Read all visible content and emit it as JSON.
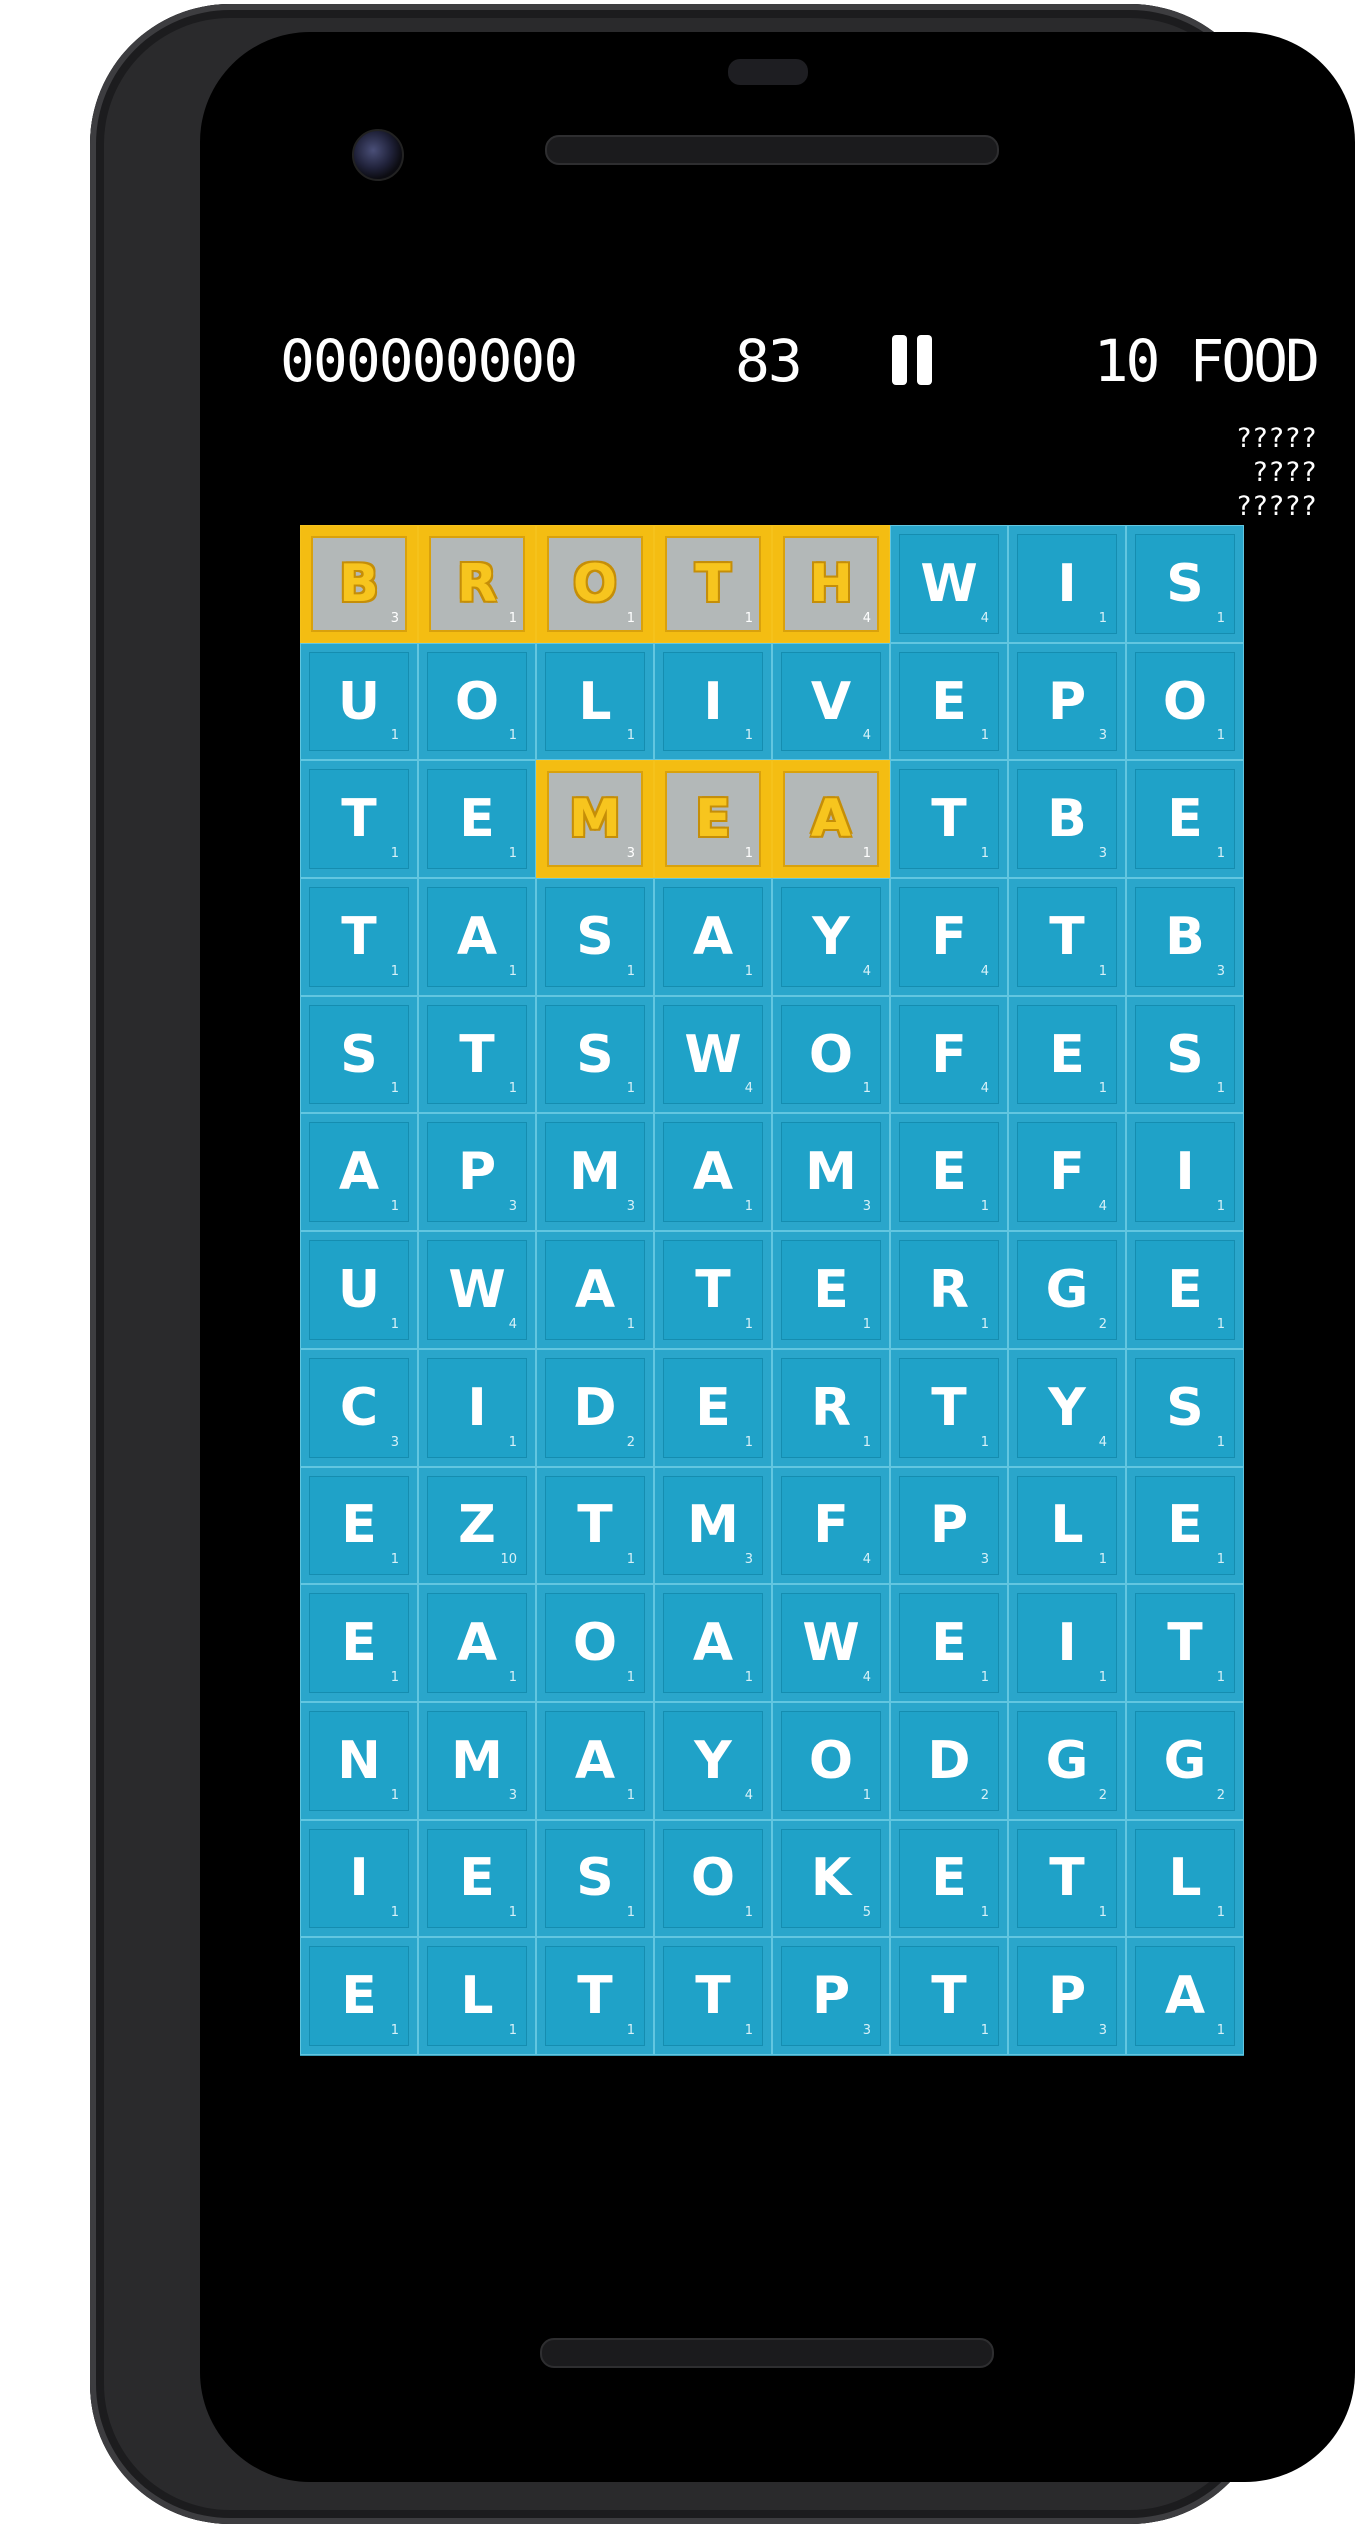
{
  "hud": {
    "score": "000000000",
    "timer": "83",
    "target": "10 FOOD"
  },
  "hints": [
    "?????",
    "????",
    "?????"
  ],
  "colors": {
    "tile": "#1fa2c8",
    "selected_tile": "#b3b8b8",
    "selected_border": "#f4bd12",
    "letter": "#ffffff",
    "selected_letter": "#f7c51e"
  },
  "board": {
    "rows": [
      [
        {
          "l": "B",
          "p": "3",
          "s": true
        },
        {
          "l": "R",
          "p": "1",
          "s": true
        },
        {
          "l": "O",
          "p": "1",
          "s": true
        },
        {
          "l": "T",
          "p": "1",
          "s": true
        },
        {
          "l": "H",
          "p": "4",
          "s": true
        },
        {
          "l": "W",
          "p": "4"
        },
        {
          "l": "I",
          "p": "1"
        },
        {
          "l": "S",
          "p": "1"
        }
      ],
      [
        {
          "l": "U",
          "p": "1"
        },
        {
          "l": "O",
          "p": "1"
        },
        {
          "l": "L",
          "p": "1"
        },
        {
          "l": "I",
          "p": "1"
        },
        {
          "l": "V",
          "p": "4"
        },
        {
          "l": "E",
          "p": "1"
        },
        {
          "l": "P",
          "p": "3"
        },
        {
          "l": "O",
          "p": "1"
        }
      ],
      [
        {
          "l": "T",
          "p": "1"
        },
        {
          "l": "E",
          "p": "1"
        },
        {
          "l": "M",
          "p": "3",
          "s": true
        },
        {
          "l": "E",
          "p": "1",
          "s": true
        },
        {
          "l": "A",
          "p": "1",
          "s": true
        },
        {
          "l": "T",
          "p": "1"
        },
        {
          "l": "B",
          "p": "3"
        },
        {
          "l": "E",
          "p": "1"
        }
      ],
      [
        {
          "l": "T",
          "p": "1"
        },
        {
          "l": "A",
          "p": "1"
        },
        {
          "l": "S",
          "p": "1"
        },
        {
          "l": "A",
          "p": "1"
        },
        {
          "l": "Y",
          "p": "4"
        },
        {
          "l": "F",
          "p": "4"
        },
        {
          "l": "T",
          "p": "1"
        },
        {
          "l": "B",
          "p": "3"
        }
      ],
      [
        {
          "l": "S",
          "p": "1"
        },
        {
          "l": "T",
          "p": "1"
        },
        {
          "l": "S",
          "p": "1"
        },
        {
          "l": "W",
          "p": "4"
        },
        {
          "l": "O",
          "p": "1"
        },
        {
          "l": "F",
          "p": "4"
        },
        {
          "l": "E",
          "p": "1"
        },
        {
          "l": "S",
          "p": "1"
        }
      ],
      [
        {
          "l": "A",
          "p": "1"
        },
        {
          "l": "P",
          "p": "3"
        },
        {
          "l": "M",
          "p": "3"
        },
        {
          "l": "A",
          "p": "1"
        },
        {
          "l": "M",
          "p": "3"
        },
        {
          "l": "E",
          "p": "1"
        },
        {
          "l": "F",
          "p": "4"
        },
        {
          "l": "I",
          "p": "1"
        }
      ],
      [
        {
          "l": "U",
          "p": "1"
        },
        {
          "l": "W",
          "p": "4"
        },
        {
          "l": "A",
          "p": "1"
        },
        {
          "l": "T",
          "p": "1"
        },
        {
          "l": "E",
          "p": "1"
        },
        {
          "l": "R",
          "p": "1"
        },
        {
          "l": "G",
          "p": "2"
        },
        {
          "l": "E",
          "p": "1"
        }
      ],
      [
        {
          "l": "C",
          "p": "3"
        },
        {
          "l": "I",
          "p": "1"
        },
        {
          "l": "D",
          "p": "2"
        },
        {
          "l": "E",
          "p": "1"
        },
        {
          "l": "R",
          "p": "1"
        },
        {
          "l": "T",
          "p": "1"
        },
        {
          "l": "Y",
          "p": "4"
        },
        {
          "l": "S",
          "p": "1"
        }
      ],
      [
        {
          "l": "E",
          "p": "1"
        },
        {
          "l": "Z",
          "p": "10"
        },
        {
          "l": "T",
          "p": "1"
        },
        {
          "l": "M",
          "p": "3"
        },
        {
          "l": "F",
          "p": "4"
        },
        {
          "l": "P",
          "p": "3"
        },
        {
          "l": "L",
          "p": "1"
        },
        {
          "l": "E",
          "p": "1"
        }
      ],
      [
        {
          "l": "E",
          "p": "1"
        },
        {
          "l": "A",
          "p": "1"
        },
        {
          "l": "O",
          "p": "1"
        },
        {
          "l": "A",
          "p": "1"
        },
        {
          "l": "W",
          "p": "4"
        },
        {
          "l": "E",
          "p": "1"
        },
        {
          "l": "I",
          "p": "1"
        },
        {
          "l": "T",
          "p": "1"
        }
      ],
      [
        {
          "l": "N",
          "p": "1"
        },
        {
          "l": "M",
          "p": "3"
        },
        {
          "l": "A",
          "p": "1"
        },
        {
          "l": "Y",
          "p": "4"
        },
        {
          "l": "O",
          "p": "1"
        },
        {
          "l": "D",
          "p": "2"
        },
        {
          "l": "G",
          "p": "2"
        },
        {
          "l": "G",
          "p": "2"
        }
      ],
      [
        {
          "l": "I",
          "p": "1"
        },
        {
          "l": "E",
          "p": "1"
        },
        {
          "l": "S",
          "p": "1"
        },
        {
          "l": "O",
          "p": "1"
        },
        {
          "l": "K",
          "p": "5"
        },
        {
          "l": "E",
          "p": "1"
        },
        {
          "l": "T",
          "p": "1"
        },
        {
          "l": "L",
          "p": "1"
        }
      ],
      [
        {
          "l": "E",
          "p": "1"
        },
        {
          "l": "L",
          "p": "1"
        },
        {
          "l": "T",
          "p": "1"
        },
        {
          "l": "T",
          "p": "1"
        },
        {
          "l": "P",
          "p": "3"
        },
        {
          "l": "T",
          "p": "1"
        },
        {
          "l": "P",
          "p": "3"
        },
        {
          "l": "A",
          "p": "1"
        }
      ]
    ]
  }
}
